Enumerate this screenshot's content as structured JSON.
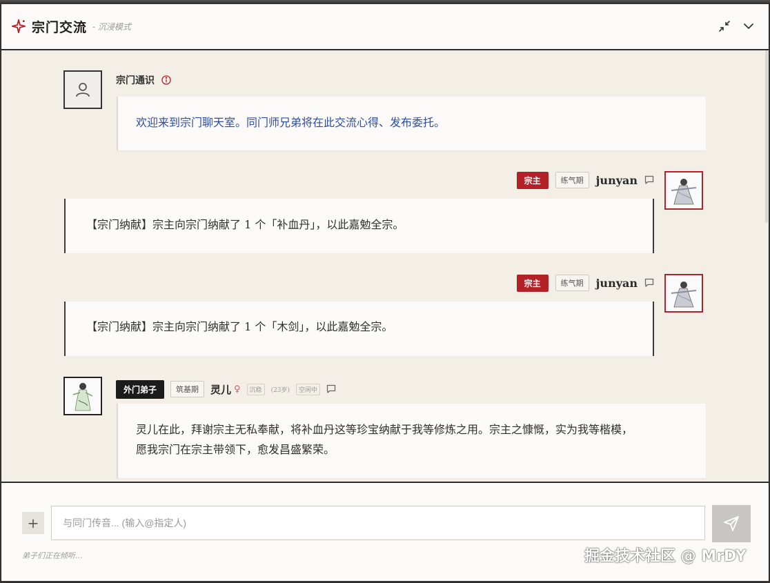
{
  "header": {
    "title": "宗门交流",
    "subtitle": "- 沉浸模式"
  },
  "messages": {
    "system": {
      "name": "宗门通识",
      "text": "欢迎来到宗门聊天室。同门师兄弟将在此交流心得、发布委托。"
    },
    "m1": {
      "role": "宗主",
      "realm": "练气期",
      "user": "junyan",
      "text": "【宗门纳献】宗主向宗门纳献了 1 个「补血丹」，以此嘉勉全宗。"
    },
    "m2": {
      "role": "宗主",
      "realm": "练气期",
      "user": "junyan",
      "text": "【宗门纳献】宗主向宗门纳献了 1 个「木剑」，以此嘉勉全宗。"
    },
    "m3": {
      "role": "外门弟子",
      "realm": "筑基期",
      "user": "灵儿",
      "gender": "♀",
      "temper": "沉稳",
      "age": "(23岁)",
      "state": "空闲中",
      "line1": "灵儿在此，拜谢宗主无私奉献，将补血丹这等珍宝纳献于我等修炼之用。宗主之慷慨，实为我等楷模，",
      "line2": "愿我宗门在宗主带领下，愈发昌盛繁荣。"
    }
  },
  "composer": {
    "placeholder": "与同门传音... (输入@指定人)",
    "status": "弟子们正在倾听..."
  },
  "watermark": "掘金技术社区 @ MrDY",
  "colors": {
    "accent": "#b32025",
    "background": "#f3efe7",
    "bubble": "#fbfaf8",
    "system_text": "#2f4ea0"
  },
  "icons": {
    "logo": "sparkle-icon",
    "minimize": "minimize-icon",
    "collapse": "chevron-down-icon",
    "system_avatar": "user-icon",
    "info": "info-icon",
    "reply": "comment-icon",
    "add": "plus-icon",
    "send": "send-icon"
  }
}
